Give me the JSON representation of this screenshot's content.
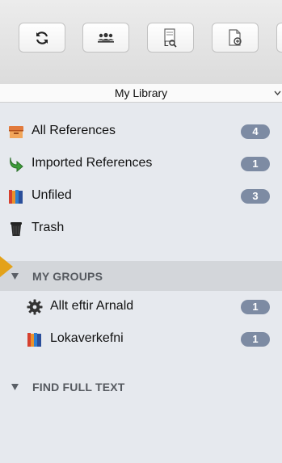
{
  "toolbar": {
    "buttons": [
      {
        "name": "sync",
        "icon": "sync-icon"
      },
      {
        "name": "new-group",
        "icon": "group-icon"
      },
      {
        "name": "new-item-by-identifier",
        "icon": "lookup-icon"
      },
      {
        "name": "new-note",
        "icon": "note-icon"
      }
    ]
  },
  "library": {
    "title": "My Library",
    "chevron_icon": "chevron-down-icon"
  },
  "collections": [
    {
      "label": "All References",
      "icon": "library-box-icon",
      "count": "4"
    },
    {
      "label": "Imported References",
      "icon": "import-arrow-icon",
      "count": "1"
    },
    {
      "label": "Unfiled",
      "icon": "books-icon",
      "count": "3"
    },
    {
      "label": "Trash",
      "icon": "trash-icon"
    }
  ],
  "groups_section": {
    "title": "MY GROUPS",
    "expand_icon": "disclosure-triangle-icon",
    "items": [
      {
        "label": "Allt eftir Arnald",
        "icon": "gear-icon",
        "count": "1"
      },
      {
        "label": "Lokaverkefni",
        "icon": "books-icon",
        "count": "1"
      }
    ]
  },
  "find_full_text": {
    "title": "FIND FULL TEXT",
    "expand_icon": "disclosure-triangle-icon"
  },
  "colors": {
    "badge": "#7d8ba3",
    "sidebar_bg": "#e6e9ee",
    "selected_section": "#d3d6da",
    "indicator_arrow": "#e3a21a"
  }
}
